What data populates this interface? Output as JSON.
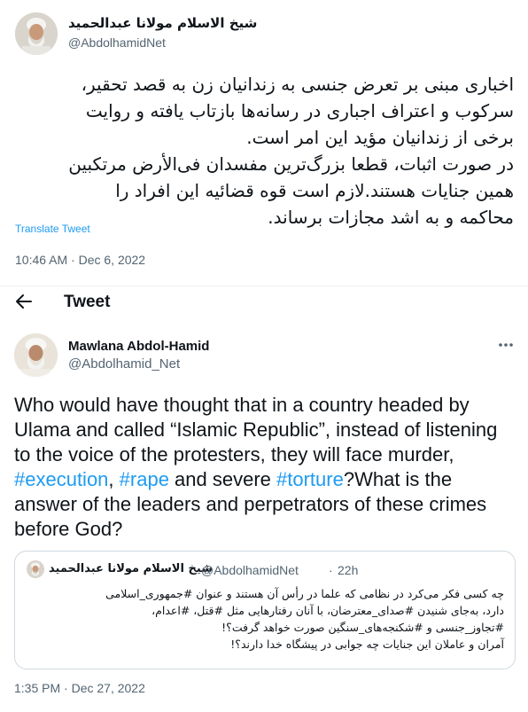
{
  "tweet1": {
    "author_name": "شیخ الاسلام مولانا عبدالحمید",
    "author_handle": "@AbdolhamidNet",
    "body_lines": [
      "اخباری مبنی بر تعرض جنسی به زندانیان زن به قصد تحقیر،",
      "سرکوب و اعتراف اجباری در رسانه‌ها بازتاب یافته و روایت",
      "برخی از زندانیان مؤید این امر است.",
      "در صورت اثبات، قطعا بزرگ‌ترین مفسدان فی‌الأرض مرتکبین",
      "همین جنایات هستند.لازم است قوه قضائیه این افراد را",
      "محاکمه و به اشد مجازات برساند."
    ],
    "translate_label": "Translate Tweet",
    "timestamp": "10:46 AM · Dec 6, 2022"
  },
  "header": {
    "title": "Tweet",
    "back_icon": "arrow-left-icon"
  },
  "tweet2": {
    "author_name": "Mawlana Abdol-Hamid",
    "author_handle": "@Abdolhamid_Net",
    "more_icon": "more-horizontal-icon",
    "body": {
      "line1": "Who would have thought that in a country headed by",
      "line2": "Ulama and called “Islamic Republic”, instead of listening",
      "line3": "to the voice of the protesters, they will face murder,",
      "hashtag_execution": "#execution",
      "sep1": ", ",
      "hashtag_rape": "#rape",
      "mid": " and severe ",
      "hashtag_torture": "#torture",
      "line4_tail": "?What is the",
      "line5": "answer of the leaders and perpetrators of these crimes",
      "line6": "before God?"
    },
    "timestamp": "1:35 PM · Dec 27, 2022"
  },
  "quoted_tweet": {
    "author_name": "شیخ الاسلام مولانا عبدالحمید",
    "author_handle": "@AbdolhamidNet",
    "dot": "·",
    "time": "22h",
    "body_lines": [
      "چه کسی فکر می‌کرد در نظامی که علما در رأس آن هستند و عنوان #جمهوری_اسلامی",
      "دارد، به‌جای شنیدن #صدای_معترضان، با آنان رفتارهایی مثل #قتل، #اعدام،",
      "#تجاوز_جنسی و #شکنجه‌های_سنگین صورت خواهد گرفت؟!",
      "آمران و عاملان این جنایات چه جوابی در پیشگاه خدا دارند؟!"
    ]
  },
  "colors": {
    "link": "#1d9bf0",
    "secondary_text": "#536471",
    "primary_text": "#0f1419",
    "border": "#cfd9de"
  }
}
